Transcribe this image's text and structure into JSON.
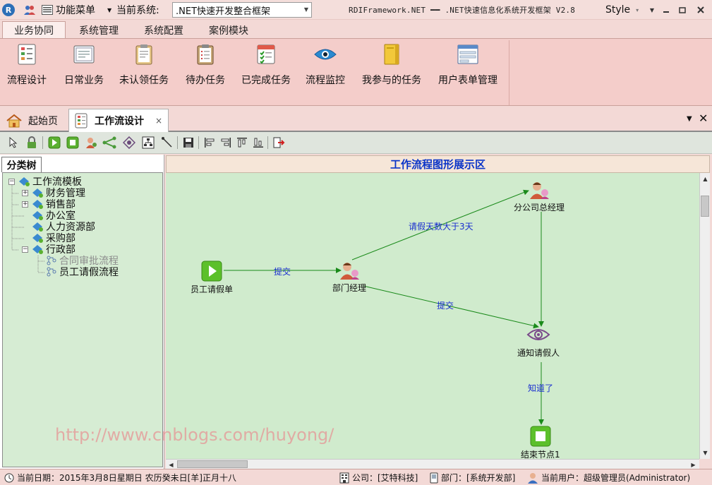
{
  "titlebar": {
    "logo_letter": "R",
    "menu_label": "功能菜单",
    "current_system_label": "当前系统:",
    "current_system_value": ".NET快速开发整合框架",
    "title": "RDIFramework.NET ━━ .NET快速信息化系统开发框架 V2.8",
    "style_label": "Style"
  },
  "ribbon_tabs": [
    {
      "label": "业务协同",
      "active": true
    },
    {
      "label": "系统管理",
      "active": false
    },
    {
      "label": "系统配置",
      "active": false
    },
    {
      "label": "案例模块",
      "active": false
    }
  ],
  "ribbon_buttons": [
    {
      "label": "流程设计",
      "icon": "flow-design-icon"
    },
    {
      "label": "日常业务",
      "icon": "daily-business-icon"
    },
    {
      "label": "未认领任务",
      "icon": "unclaimed-task-icon"
    },
    {
      "label": "待办任务",
      "icon": "todo-task-icon"
    },
    {
      "label": "已完成任务",
      "icon": "completed-task-icon"
    },
    {
      "label": "流程监控",
      "icon": "eye-icon"
    },
    {
      "label": "我参与的任务",
      "icon": "folder-icon"
    },
    {
      "label": "用户表单管理",
      "icon": "form-icon"
    }
  ],
  "doc_tabs": [
    {
      "label": "起始页",
      "active": false
    },
    {
      "label": "工作流设计",
      "active": true,
      "closable": true
    }
  ],
  "left_panel": {
    "tab_label": "分类树",
    "tree": [
      {
        "label": "工作流模板",
        "level": 0,
        "expander": "−"
      },
      {
        "label": "财务管理",
        "level": 1,
        "expander": "+"
      },
      {
        "label": "销售部",
        "level": 1,
        "expander": "+"
      },
      {
        "label": "办公室",
        "level": 1,
        "expander": ""
      },
      {
        "label": "人力资源部",
        "level": 1,
        "expander": ""
      },
      {
        "label": "采购部",
        "level": 1,
        "expander": ""
      },
      {
        "label": "行政部",
        "level": 1,
        "expander": "−"
      },
      {
        "label": "合同审批流程",
        "level": 2,
        "expander": "",
        "disabled": true
      },
      {
        "label": "员工请假流程",
        "level": 2,
        "expander": ""
      }
    ]
  },
  "canvas": {
    "header": "工作流程图形展示区",
    "nodes": [
      {
        "id": "start",
        "label": "员工请假单",
        "type": "start"
      },
      {
        "id": "dept",
        "label": "部门经理",
        "type": "user"
      },
      {
        "id": "branch",
        "label": "分公司总经理",
        "type": "user"
      },
      {
        "id": "notify",
        "label": "通知请假人",
        "type": "notify"
      },
      {
        "id": "end",
        "label": "结束节点1",
        "type": "end"
      }
    ],
    "edges": [
      {
        "from": "start",
        "to": "dept",
        "label": "提交"
      },
      {
        "from": "dept",
        "to": "branch",
        "label": "请假天数大于3天"
      },
      {
        "from": "dept",
        "to": "notify",
        "label": "提交"
      },
      {
        "from": "branch",
        "to": "notify",
        "label": ""
      },
      {
        "from": "notify",
        "to": "end",
        "label": "知道了"
      }
    ],
    "watermark": "http://www.cnblogs.com/huyong/"
  },
  "statusbar": {
    "date": "当前日期：2015年3月8日星期日 农历癸未日[羊]正月十八",
    "company": "公司：[艾特科技]",
    "department": "部门：[系统开发部]",
    "user": "当前用户：超级管理员(Administrator)"
  },
  "colors": {
    "ribbon_bg": "#f4cdca",
    "canvas_bg": "#d0ebcd",
    "tree_bg": "#d6ecd3",
    "edge": "#1a8a1a",
    "edge_label": "#1a2fd0",
    "canvas_header_text": "#0a34c8"
  }
}
